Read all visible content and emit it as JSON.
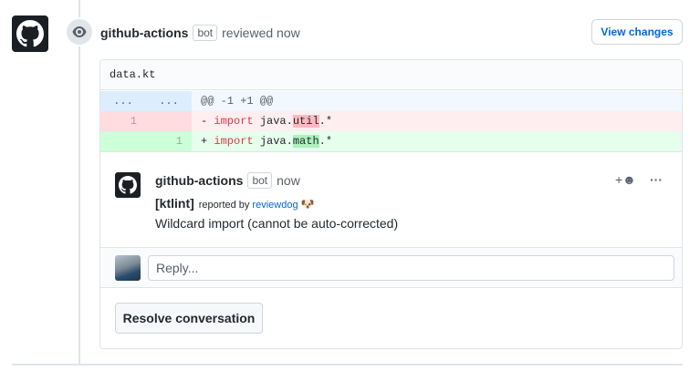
{
  "review": {
    "author": "github-actions",
    "bot_label": "bot",
    "action": "reviewed now",
    "view_changes_label": "View changes"
  },
  "diff": {
    "file_name": "data.kt",
    "hunk_left": "...",
    "hunk_right": "...",
    "hunk_header": "@@ -1 +1 @@",
    "deleted": {
      "line_num": "1",
      "prefix": "- ",
      "keyword": "import",
      "before": " java.",
      "highlight": "util",
      "after": ".*"
    },
    "added": {
      "line_num": "1",
      "prefix": "+ ",
      "keyword": "import",
      "before": " java.",
      "highlight": "math",
      "after": ".*"
    }
  },
  "comment": {
    "author": "github-actions",
    "bot_label": "bot",
    "time": "now",
    "reaction_icon": "+☻",
    "more_icon": "···",
    "tag": "[ktlint]",
    "reported_by": "reported by",
    "reporter": "reviewdog",
    "reporter_emoji": "🐶",
    "body": "Wildcard import (cannot be auto-corrected)"
  },
  "reply": {
    "placeholder": "Reply..."
  },
  "resolve_label": "Resolve conversation",
  "colors": {
    "link": "#0366d6",
    "deletion_bg": "#ffeef0",
    "addition_bg": "#e6ffed",
    "hunk_bg": "#f1f8ff"
  }
}
